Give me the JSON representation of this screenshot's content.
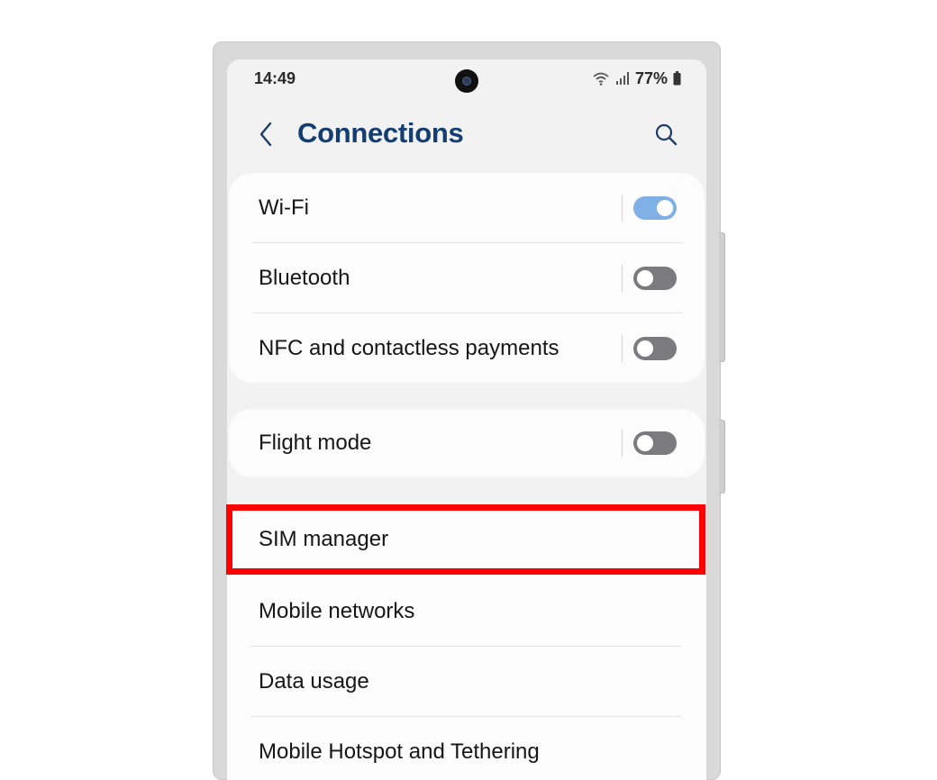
{
  "status_bar": {
    "time": "14:49",
    "battery": "77%",
    "icons": [
      "wifi-icon",
      "signal-icon",
      "battery-icon"
    ]
  },
  "header": {
    "title": "Connections",
    "back_icon": "chevron-left-icon",
    "search_icon": "search-icon"
  },
  "toggle_groups": [
    {
      "items": [
        {
          "label": "Wi-Fi",
          "on": true
        },
        {
          "label": "Bluetooth",
          "on": false
        },
        {
          "label": "NFC and contactless payments",
          "on": false
        }
      ]
    },
    {
      "items": [
        {
          "label": "Flight mode",
          "on": false
        }
      ]
    }
  ],
  "menu_items": [
    {
      "label": "SIM manager",
      "highlighted": true
    },
    {
      "label": "Mobile networks"
    },
    {
      "label": "Data usage"
    },
    {
      "label": "Mobile Hotspot and Tethering"
    }
  ],
  "colors": {
    "title": "#143e72",
    "toggle_on": "#7fb0e6",
    "toggle_off": "#7b7b7f",
    "highlight": "#ff0000"
  }
}
